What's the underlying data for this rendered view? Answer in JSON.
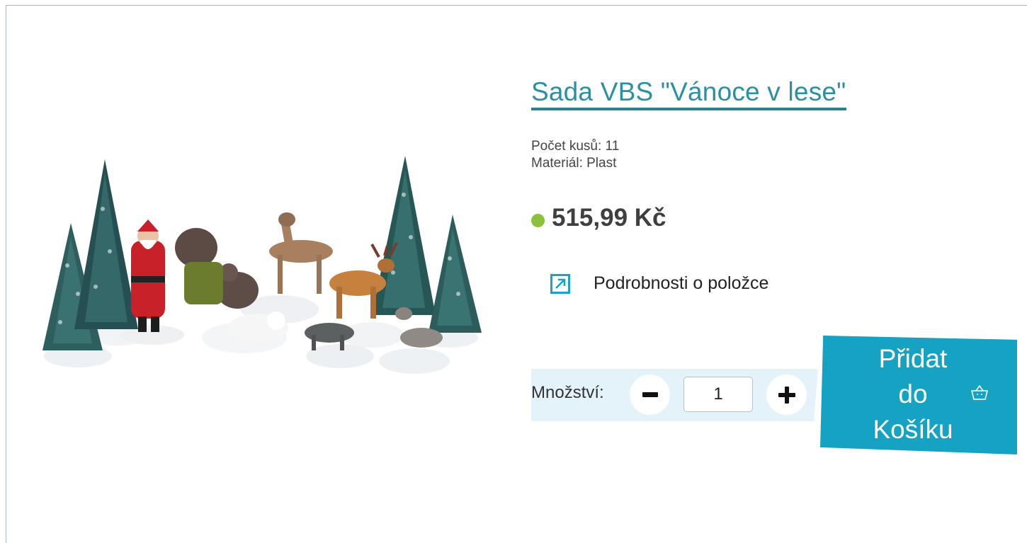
{
  "product": {
    "title": "Sada VBS \"Vánoce v lese\"",
    "specs": [
      "Počet kusů: 11",
      "Materiál: Plast"
    ],
    "price": "515,99 Kč",
    "availability_color": "#8ec13b",
    "details_link_label": "Podrobnosti o položce",
    "details_icon": "external-link-icon",
    "image_alt": "Christmas forest figurine set with Santa, deer, wolves, bears and snowy trees"
  },
  "quantity": {
    "label": "Množství:",
    "value": "1",
    "minus_icon": "minus-icon",
    "plus_icon": "plus-icon"
  },
  "cart": {
    "label_lines": [
      "Přidat",
      "do",
      "Košíku"
    ],
    "icon": "basket-icon",
    "color": "#16a2c3"
  }
}
